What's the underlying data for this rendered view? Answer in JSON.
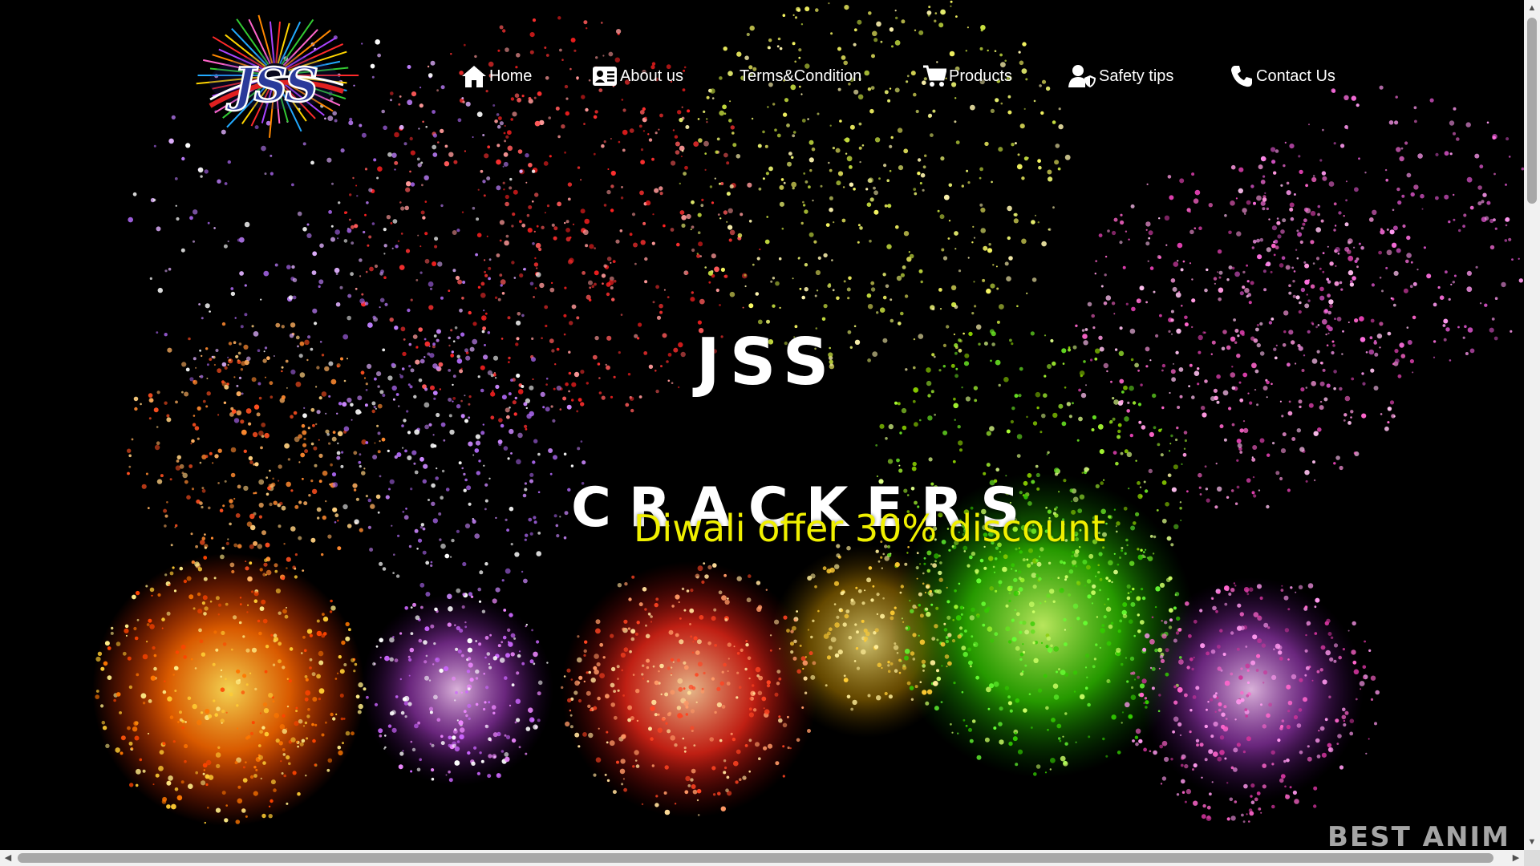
{
  "logo": {
    "text": "JSS"
  },
  "nav": [
    {
      "label": "Home",
      "icon": "home-icon"
    },
    {
      "label": "About us",
      "icon": "id-card-icon"
    },
    {
      "label": "Terms&Condition",
      "icon": ""
    },
    {
      "label": "Products",
      "icon": "cart-icon"
    },
    {
      "label": "Safety tips",
      "icon": "user-shield-icon"
    },
    {
      "label": "Contact Us",
      "icon": "phone-icon"
    }
  ],
  "hero": {
    "title_line1": "JSS",
    "title_line2": "CRACKERS",
    "offer": "Diwali offer 30% discount",
    "watermark": "BEST ANIM"
  },
  "colors": {
    "background": "#000000",
    "nav_text": "#ffffff",
    "title_text": "#ffffff",
    "offer_text": "#f0f000",
    "scrollbar_track": "#f1f1f1",
    "scrollbar_thumb": "#a8a8a8"
  }
}
